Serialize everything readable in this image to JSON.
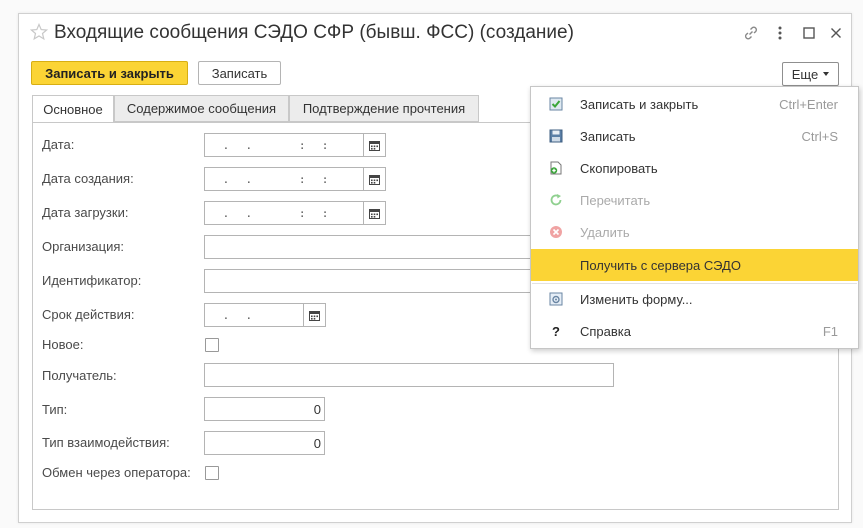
{
  "window": {
    "title": "Входящие сообщения СЭДО СФР (бывш. ФСС) (создание)"
  },
  "toolbar": {
    "save_close_label": "Записать и закрыть",
    "save_label": "Записать",
    "more_label": "Еще"
  },
  "tabs": [
    {
      "label": "Основное",
      "active": true
    },
    {
      "label": "Содержимое сообщения",
      "active": false
    },
    {
      "label": "Подтверждение прочтения",
      "active": false
    }
  ],
  "form": {
    "date": {
      "label": "Дата:",
      "value": " .  .      :  :"
    },
    "created": {
      "label": "Дата создания:",
      "value": " .  .      :  :"
    },
    "loaded": {
      "label": "Дата загрузки:",
      "value": " .  .      :  :"
    },
    "organization": {
      "label": "Организация:",
      "value": ""
    },
    "identifier": {
      "label": "Идентификатор:",
      "value": ""
    },
    "validity": {
      "label": "Срок действия:",
      "value": " .  ."
    },
    "is_new": {
      "label": "Новое:",
      "checked": false
    },
    "recipient": {
      "label": "Получатель:",
      "value": ""
    },
    "type": {
      "label": "Тип:",
      "value": "0"
    },
    "interaction_type": {
      "label": "Тип взаимодействия:",
      "value": "0"
    },
    "via_operator": {
      "label": "Обмен через оператора:",
      "checked": false
    }
  },
  "menu": {
    "items": [
      {
        "label": "Записать и закрыть",
        "shortcut": "Ctrl+Enter",
        "icon": "save-close-icon",
        "enabled": true
      },
      {
        "label": "Записать",
        "shortcut": "Ctrl+S",
        "icon": "floppy-icon",
        "enabled": true
      },
      {
        "label": "Скопировать",
        "shortcut": "",
        "icon": "copy-icon",
        "enabled": true
      },
      {
        "label": "Перечитать",
        "shortcut": "",
        "icon": "refresh-icon",
        "enabled": false
      },
      {
        "label": "Удалить",
        "shortcut": "",
        "icon": "delete-icon",
        "enabled": false
      },
      {
        "label": "Получить с сервера СЭДО",
        "shortcut": "",
        "icon": "",
        "enabled": true,
        "highlighted": true
      },
      {
        "label": "Изменить форму...",
        "shortcut": "",
        "icon": "form-settings-icon",
        "enabled": true
      },
      {
        "label": "Справка",
        "shortcut": "F1",
        "icon": "help-icon",
        "enabled": true
      }
    ]
  },
  "colors": {
    "accent": "#fbd435",
    "disabled_text": "#aaaaaa"
  }
}
